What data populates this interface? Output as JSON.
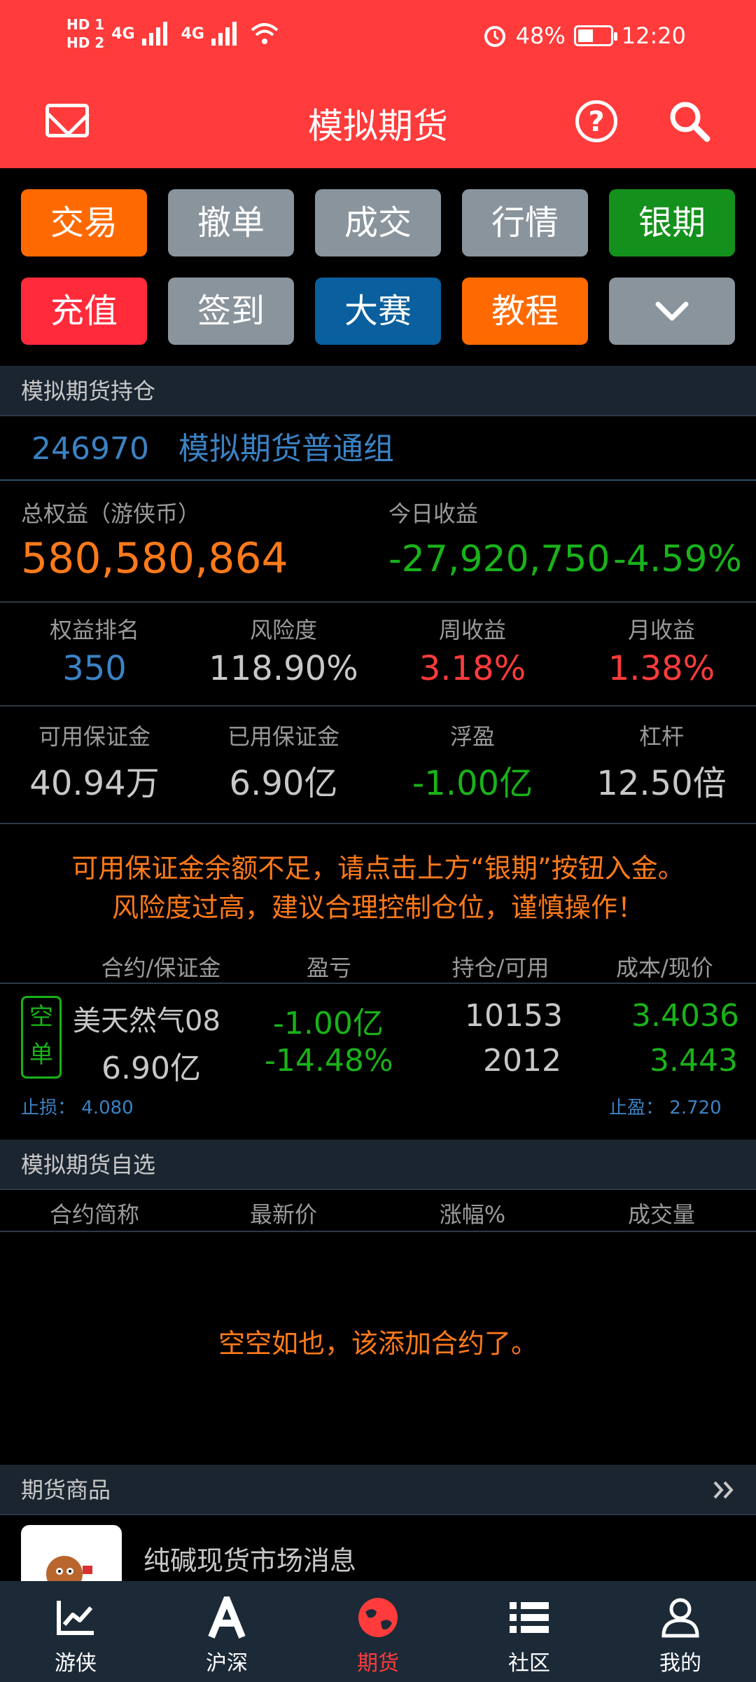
{
  "status_bar": {
    "sim1": "HD 1",
    "sim2": "HD 2",
    "network": "4G",
    "battery": "48%",
    "battery_level": 0.48,
    "time": "12:20"
  },
  "header": {
    "title": "模拟期货"
  },
  "quick_buttons": [
    {
      "label": "交易",
      "color": "#ff6a00"
    },
    {
      "label": "撤单",
      "color": "#8a949c"
    },
    {
      "label": "成交",
      "color": "#8a949c"
    },
    {
      "label": "行情",
      "color": "#8a949c"
    },
    {
      "label": "银期",
      "color": "#14911c"
    },
    {
      "label": "充值",
      "color": "#ff2b3b"
    },
    {
      "label": "签到",
      "color": "#8a949c"
    },
    {
      "label": "大赛",
      "color": "#0a5f9e"
    },
    {
      "label": "教程",
      "color": "#ff6a00"
    }
  ],
  "positions_section": {
    "title": "模拟期货持仓",
    "account_id": "246970",
    "group": "模拟期货普通组",
    "total_equity_label": "总权益（游侠币）",
    "total_equity": "580,580,864",
    "today_pnl_label": "今日收益",
    "today_pnl": "-27,920,750",
    "today_pnl_pct": "-4.59%",
    "stats": [
      {
        "label": "权益排名",
        "value": "350",
        "color": "#3b82c4"
      },
      {
        "label": "风险度",
        "value": "118.90%",
        "color": "#c8c8c8"
      },
      {
        "label": "周收益",
        "value": "3.18%",
        "color": "#ff3b3b"
      },
      {
        "label": "月收益",
        "value": "1.38%",
        "color": "#ff3b3b"
      },
      {
        "label": "可用保证金",
        "value": "40.94万",
        "color": "#c8c8c8"
      },
      {
        "label": "已用保证金",
        "value": "6.90亿",
        "color": "#c8c8c8"
      },
      {
        "label": "浮盈",
        "value": "-1.00亿",
        "color": "#19b219"
      },
      {
        "label": "杠杆",
        "value": "12.50倍",
        "color": "#c8c8c8"
      }
    ],
    "warning_line1": "可用保证金余额不足，请点击上方“银期”按钮入金。",
    "warning_line2": "风险度过高，建议合理控制仓位，谨慎操作！",
    "table_headers": [
      "合约/保证金",
      "盈亏",
      "持仓/可用",
      "成本/现价"
    ],
    "row": {
      "tag": [
        "空",
        "单"
      ],
      "contract": "美天然气08",
      "margin": "6.90亿",
      "pnl": "-1.00亿",
      "pnl_pct": "-14.48%",
      "position": "10153",
      "available": "2012",
      "cost": "3.4036",
      "current": "3.443",
      "stop_loss_label": "止损：",
      "stop_loss": "4.080",
      "take_profit_label": "止盈：",
      "take_profit": "2.720"
    }
  },
  "watchlist_section": {
    "title": "模拟期货自选",
    "headers": [
      "合约简称",
      "最新价",
      "涨幅%",
      "成交量"
    ],
    "empty_text": "空空如也，该添加合约了。"
  },
  "products_section": {
    "title": "期货商品",
    "item_title": "纯碱现货市场消息"
  },
  "bottom_nav": [
    {
      "label": "游侠",
      "icon": "chart-icon",
      "active": false
    },
    {
      "label": "沪深",
      "icon": "letter-a-icon",
      "active": false
    },
    {
      "label": "期货",
      "icon": "globe-icon",
      "active": true
    },
    {
      "label": "社区",
      "icon": "list-icon",
      "active": false
    },
    {
      "label": "我的",
      "icon": "user-icon",
      "active": false
    }
  ]
}
